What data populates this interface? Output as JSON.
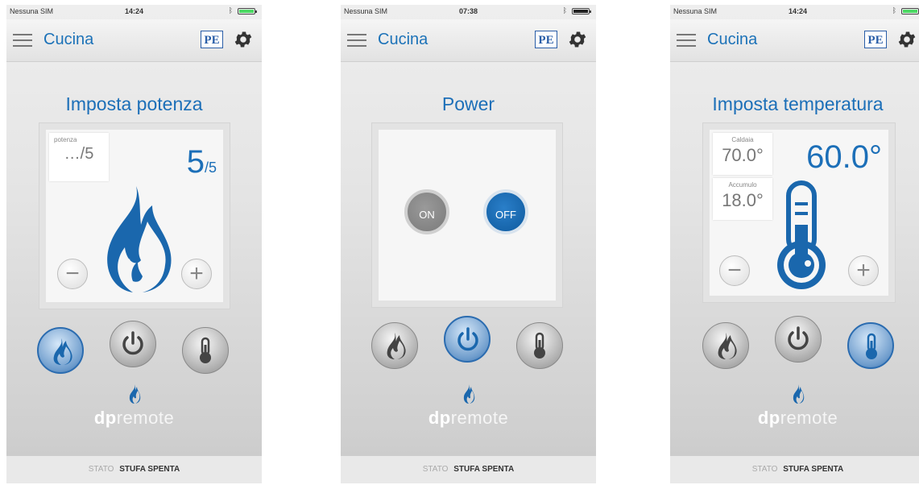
{
  "screens": [
    {
      "status": {
        "carrier": "Nessuna SIM",
        "time": "14:24",
        "battery_color": "#4cd964"
      },
      "nav": {
        "title": "Cucina",
        "badge": "PE"
      },
      "title": "Imposta potenza",
      "power": {
        "label": "potenza",
        "previous": "…/5",
        "current": "5",
        "max": "/5"
      },
      "mode_active": "power",
      "logo": {
        "bold": "dp",
        "light": "remote"
      },
      "stato": {
        "label": "STATO",
        "value": "STUFA SPENTA"
      }
    },
    {
      "status": {
        "carrier": "Nessuna SIM",
        "time": "07:38",
        "battery_color": "#222222"
      },
      "nav": {
        "title": "Cucina",
        "badge": "PE"
      },
      "title": "Power",
      "toggle": {
        "on": "ON",
        "off": "OFF",
        "selected": "OFF"
      },
      "mode_active": "onoff",
      "logo": {
        "bold": "dp",
        "light": "remote"
      },
      "stato": {
        "label": "STATO",
        "value": "STUFA SPENTA"
      }
    },
    {
      "status": {
        "carrier": "Nessuna SIM",
        "time": "14:24",
        "battery_color": "#4cd964"
      },
      "nav": {
        "title": "Cucina",
        "badge": "PE"
      },
      "title": "Imposta temperatura",
      "temperature": {
        "caldaia_label": "Caldaia",
        "caldaia_value": "70.0°",
        "accumulo_label": "Accumulo",
        "accumulo_value": "18.0°",
        "setpoint": "60.0°"
      },
      "mode_active": "temperature",
      "logo": {
        "bold": "dp",
        "light": "remote"
      },
      "stato": {
        "label": "STATO",
        "value": "STUFA SPENTA"
      }
    }
  ],
  "colors": {
    "accent": "#1c6fb8",
    "toggle_off": "#0f5a9e",
    "toggle_on": "#8a8a8a"
  },
  "icons": [
    "hamburger-menu-icon",
    "gear-icon",
    "flame-icon",
    "power-icon",
    "thermometer-icon",
    "minus-icon",
    "plus-icon"
  ]
}
